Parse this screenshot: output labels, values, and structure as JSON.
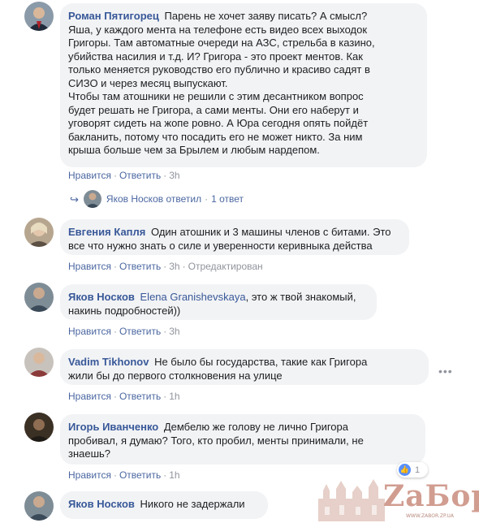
{
  "comments": [
    {
      "author": "Роман Пятигорец",
      "lines": [
        "Парень не хочет заяву писать? А смысл?",
        "Яша, у каждого мента на телефоне есть видео всех выходок",
        "Григоры. Там автоматные очереди на АЗС, стрельба в казино,",
        "убийства насилия и т.д. И? Григора - это проект ментов. Как",
        "только меняется руководство его публично и красиво садят в",
        "СИЗО и через месяц выпускают.",
        "Чтобы там атошники не решили с этим десантником вопрос",
        "будет решать не Григора, а сами менты. Они его наберут и",
        "уговорят сидеть на жопе ровно. А Юра сегодня опять пойдёт",
        "бакланить, потому что посадить его не может никто. За ним",
        "крыша больше чем за Брылем и любым нардепом."
      ],
      "like": "Нравится",
      "reply": "Ответить",
      "time": "3h"
    },
    {
      "author": "Евгения Капля",
      "lines": [
        "Один атошник и 3 машины членов с битами. Это",
        "все что нужно знать о силе и уверенности керивныка действа"
      ],
      "like": "Нравится",
      "reply": "Ответить",
      "time": "3h",
      "edited": "Отредактирован"
    },
    {
      "author": "Яков Носков",
      "mention": "Elena Granishevskaya",
      "lines": [
        ", это ж твой знакомый,",
        "накинь подробностей))"
      ],
      "like": "Нравится",
      "reply": "Ответить",
      "time": "3h"
    },
    {
      "author": "Vadim Tikhonov",
      "lines": [
        "Не было бы государства, такие как Григора",
        "жили бы до первого столкновения на улице"
      ],
      "like": "Нравится",
      "reply": "Ответить",
      "time": "1h"
    },
    {
      "author": "Игорь Иванченко",
      "lines": [
        "Дембелю же голову не лично Григора",
        "пробивал, я думаю? Того, кто пробил, менты принимали, не",
        "знаешь?"
      ],
      "like": "Нравится",
      "reply": "Ответить",
      "time": "1h",
      "reaction_count": "1"
    },
    {
      "author": "Яков Носков",
      "lines": [
        "Никого не задержали"
      ]
    }
  ],
  "reply_summary": {
    "text": "Яков Носков ответил",
    "count": "1 ответ"
  },
  "more_menu": "•••",
  "watermark": {
    "text": "ZaБор",
    "url": "WWW.ZABOR.ZP.UA"
  },
  "colors": {
    "link": "#385898",
    "bubble": "#f2f3f5",
    "meta": "#90949c",
    "like_blue": "#5890ff"
  }
}
